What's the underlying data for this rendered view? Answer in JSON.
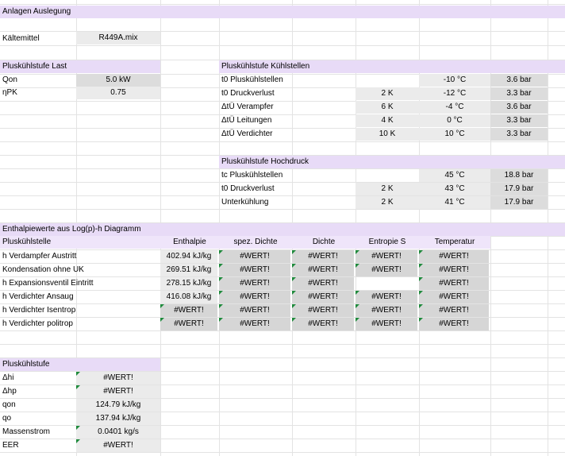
{
  "sheet": {
    "title": "Anlagen Auslegung",
    "refrigerant": {
      "label": "Kältemittel",
      "value": "R449A.mix"
    },
    "load": {
      "title": "Pluskühlstufe Last",
      "rows": [
        {
          "label": "Qon",
          "value": "5.0 kW"
        },
        {
          "label": "ηPK",
          "value": "0.75"
        }
      ]
    },
    "cooling": {
      "title": "Pluskühlstufe Kühlstellen",
      "rows": [
        {
          "label": "t0 Pluskühlstellen",
          "delta": "",
          "temp": "-10 °C",
          "pressure": "3.6 bar"
        },
        {
          "label": "t0 Druckverlust",
          "delta": "2 K",
          "temp": "-12 °C",
          "pressure": "3.3 bar"
        },
        {
          "label": "ΔtÜ Verampfer",
          "delta": "6 K",
          "temp": "-4 °C",
          "pressure": "3.6 bar"
        },
        {
          "label": "ΔtÜ Leitungen",
          "delta": "4 K",
          "temp": "0 °C",
          "pressure": "3.3 bar"
        },
        {
          "label": "ΔtÜ Verdichter",
          "delta": "10 K",
          "temp": "10 °C",
          "pressure": "3.3 bar"
        }
      ]
    },
    "highpressure": {
      "title": "Pluskühlstufe Hochdruck",
      "rows": [
        {
          "label": "tc Pluskühlstellen",
          "delta": "",
          "temp": "45 °C",
          "pressure": "18.8 bar"
        },
        {
          "label": "t0 Druckverlust",
          "delta": "2 K",
          "temp": "43 °C",
          "pressure": "17.9 bar"
        },
        {
          "label": "Unterkühlung",
          "delta": "2 K",
          "temp": "41 °C",
          "pressure": "17.9 bar"
        }
      ]
    },
    "enthalpy": {
      "title": "Enthalpiewerte aus Log(p)-h Diagramm",
      "headers": [
        "Pluskühlstelle",
        "Enthalpie",
        "spez. Dichte",
        "Dichte",
        "Entropie S",
        "Temperatur"
      ],
      "rows": [
        {
          "label": "h Verdampfer Austritt",
          "cells": [
            "402.94 kJ/kg",
            "#WERT!",
            "#WERT!",
            "#WERT!",
            "#WERT!"
          ]
        },
        {
          "label": "Kondensation ohne UK",
          "cells": [
            "269.51 kJ/kg",
            "#WERT!",
            "#WERT!",
            "#WERT!",
            "#WERT!"
          ]
        },
        {
          "label": "h Expansionsventil Eintritt",
          "cells": [
            "278.15 kJ/kg",
            "#WERT!",
            "#WERT!",
            "",
            "#WERT!"
          ]
        },
        {
          "label": "h Verdichter Ansaug",
          "cells": [
            "416.08 kJ/kg",
            "#WERT!",
            "#WERT!",
            "#WERT!",
            "#WERT!"
          ]
        },
        {
          "label": "h Verdichter Isentrop",
          "cells": [
            "#WERT!",
            "#WERT!",
            "#WERT!",
            "#WERT!",
            "#WERT!"
          ]
        },
        {
          "label": "h Verdichter politrop",
          "cells": [
            "#WERT!",
            "#WERT!",
            "#WERT!",
            "#WERT!",
            "#WERT!"
          ]
        }
      ]
    },
    "summary": {
      "title": "Pluskühlstufe",
      "rows": [
        {
          "label": "Δhi",
          "value": "#WERT!"
        },
        {
          "label": "Δhp",
          "value": "#WERT!"
        },
        {
          "label": "qon",
          "value": "124.79 kJ/kg"
        },
        {
          "label": "qo",
          "value": "137.94 kJ/kg"
        },
        {
          "label": "Massenstrom",
          "value": "0.0401 kg/s"
        },
        {
          "label": "EER",
          "value": "#WERT!"
        }
      ]
    }
  }
}
